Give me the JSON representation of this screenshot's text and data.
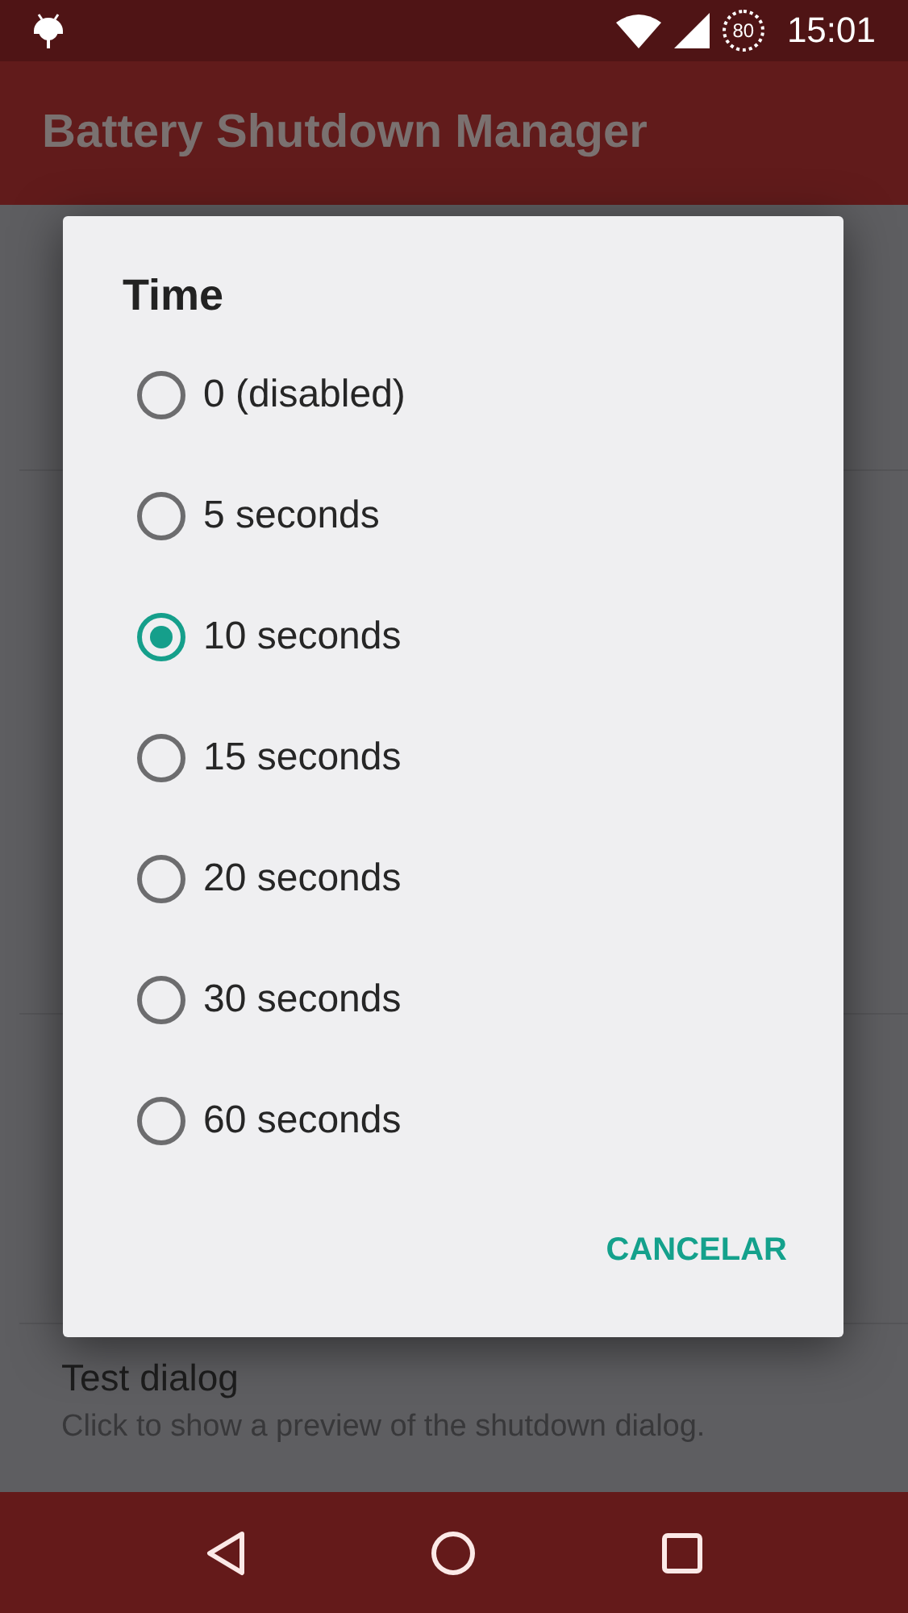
{
  "status_bar": {
    "battery": "80",
    "time": "15:01"
  },
  "app_bar": {
    "title": "Battery Shutdown Manager"
  },
  "settings": [
    {
      "title": "Test dialog",
      "summary": "Click to show a preview of the shutdown dialog."
    }
  ],
  "dialog": {
    "title": "Time",
    "options": [
      {
        "label": "0 (disabled)",
        "selected": false
      },
      {
        "label": "5 seconds",
        "selected": false
      },
      {
        "label": "10 seconds",
        "selected": true
      },
      {
        "label": "15 seconds",
        "selected": false
      },
      {
        "label": "20 seconds",
        "selected": false
      },
      {
        "label": "30 seconds",
        "selected": false
      },
      {
        "label": "60 seconds",
        "selected": false
      }
    ],
    "button": "CANCELAR"
  }
}
